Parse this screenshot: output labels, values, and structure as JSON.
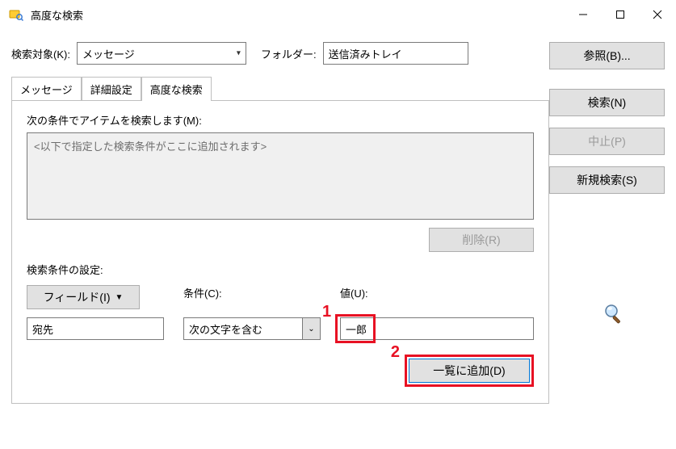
{
  "window": {
    "title": "高度な検索"
  },
  "toprow": {
    "target_label": "検索対象(K):",
    "target_value": "メッセージ",
    "folder_label": "フォルダー:",
    "folder_value": "送信済みトレイ"
  },
  "sidebuttons": {
    "browse": "参照(B)...",
    "search": "検索(N)",
    "stop": "中止(P)",
    "newsearch": "新規検索(S)"
  },
  "tabs": {
    "t1": "メッセージ",
    "t2": "詳細設定",
    "t3": "高度な検索"
  },
  "panel": {
    "find_label": "次の条件でアイテムを検索します(M):",
    "criteria_placeholder": "<以下で指定した検索条件がここに追加されます>",
    "remove_label": "削除(R)",
    "define_label": "検索条件の設定:",
    "field_btn": "フィールド(I)",
    "cond_label": "条件(C):",
    "value_label": "値(U):",
    "field_value": "宛先",
    "cond_value": "次の文字を含む",
    "value_value": "一郎",
    "add_label": "一覧に追加(D)"
  },
  "annotations": {
    "n1": "1",
    "n2": "2"
  }
}
